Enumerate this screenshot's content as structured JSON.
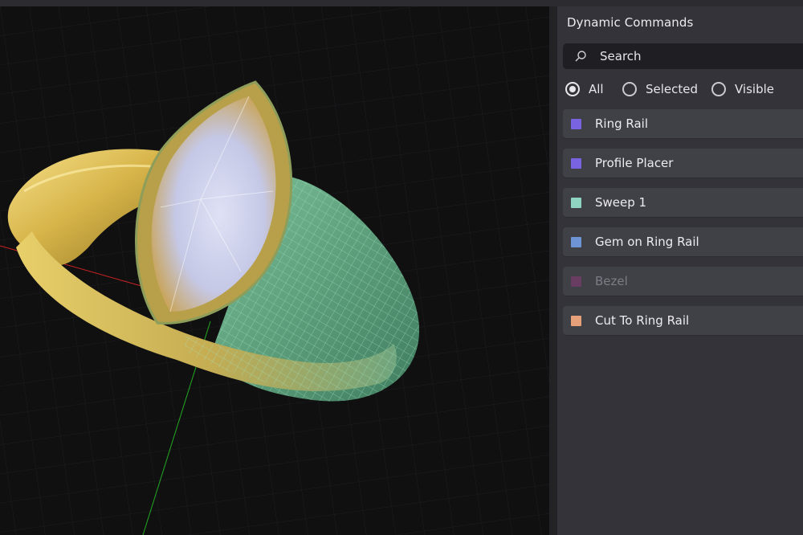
{
  "panel": {
    "title": "Dynamic Commands",
    "search": {
      "label": "Search"
    },
    "filters": [
      {
        "label": "All",
        "checked": true
      },
      {
        "label": "Selected",
        "checked": false
      },
      {
        "label": "Visible",
        "checked": false
      }
    ],
    "commands": [
      {
        "label": "Ring Rail",
        "color": "#7a63e0",
        "enabled": true
      },
      {
        "label": "Profile Placer",
        "color": "#7a63e0",
        "enabled": true
      },
      {
        "label": "Sweep 1",
        "color": "#8fd3c1",
        "enabled": true
      },
      {
        "label": "Gem on Ring Rail",
        "color": "#6e94d6",
        "enabled": true
      },
      {
        "label": "Bezel",
        "color": "#8a3a78",
        "enabled": false
      },
      {
        "label": "Cut To Ring Rail",
        "color": "#e6a07a",
        "enabled": true
      }
    ]
  },
  "viewport": {
    "colors": {
      "gold": "#d9b84a",
      "green_mesh": "#5fa880",
      "gem": "#c9cde8",
      "axis_x": "#cc2222",
      "axis_y": "#22aa22"
    }
  }
}
